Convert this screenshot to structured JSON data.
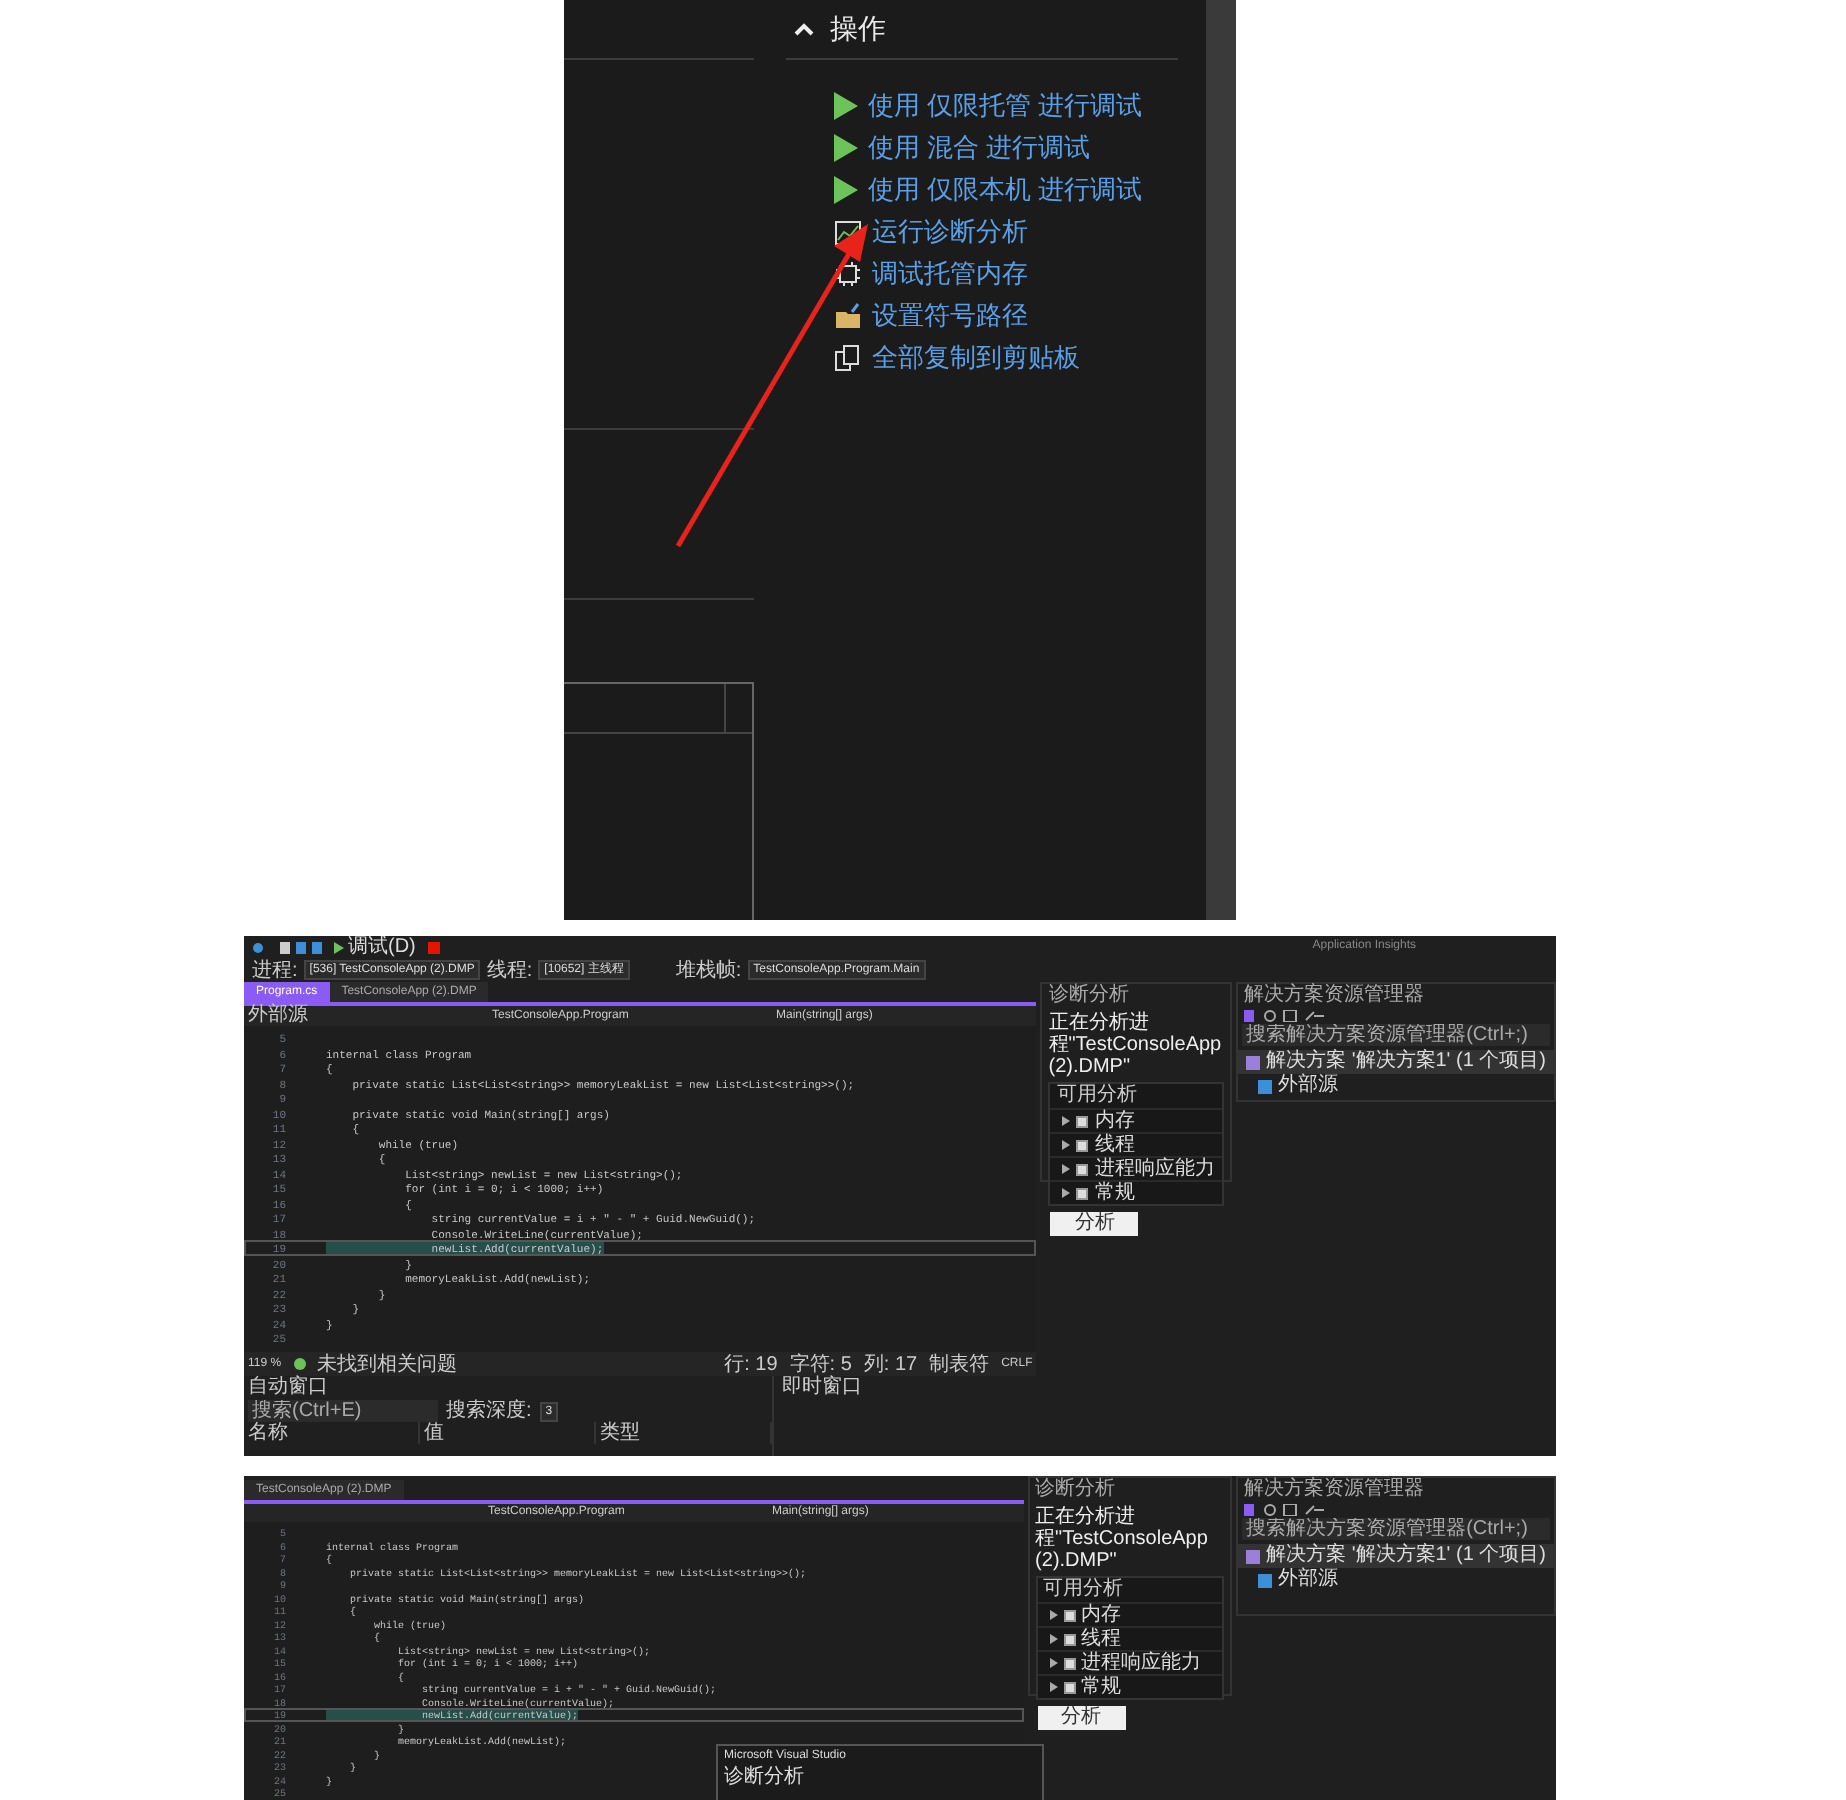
{
  "actions_panel": {
    "heading": "操作",
    "expanded": true,
    "items": [
      {
        "kind": "play",
        "label": "使用 仅限托管 进行调试"
      },
      {
        "kind": "play",
        "label": "使用 混合 进行调试"
      },
      {
        "kind": "play",
        "label": "使用 仅限本机 进行调试"
      },
      {
        "kind": "chart",
        "label": "运行诊断分析"
      },
      {
        "kind": "memory",
        "label": "调试托管内存"
      },
      {
        "kind": "folder",
        "label": "设置符号路径"
      },
      {
        "kind": "copy",
        "label": "全部复制到剪贴板"
      }
    ]
  },
  "debug_window": {
    "toolbar": {
      "debug_target": "调试(D)",
      "insights": "Application Insights",
      "process_label": "进程:",
      "process": "[536] TestConsoleApp (2).DMP",
      "thread_label": "线程:",
      "thread": "[10652] 主线程",
      "frame_label": "堆栈帧:",
      "frame": "TestConsoleApp.Program.Main"
    },
    "tabs": [
      {
        "label": "Program.cs",
        "selected": true
      },
      {
        "label": "TestConsoleApp (2).DMP",
        "selected": false
      }
    ],
    "nav": [
      "外部源",
      "TestConsoleApp.Program",
      "Main(string[] args)"
    ],
    "code": [
      {
        "no": "5"
      },
      {
        "no": "6",
        "text": "internal class Program"
      },
      {
        "no": "7",
        "text": "{"
      },
      {
        "no": "8",
        "text": "    private static List<List<string>> memoryLeakList = new List<List<string>>();"
      },
      {
        "no": "9"
      },
      {
        "no": "10",
        "text": "    private static void Main(string[] args)"
      },
      {
        "no": "11",
        "text": "    {"
      },
      {
        "no": "12",
        "text": "        while (true)"
      },
      {
        "no": "13",
        "text": "        {"
      },
      {
        "no": "14",
        "text": "            List<string> newList = new List<string>();"
      },
      {
        "no": "15",
        "text": "            for (int i = 0; i < 1000; i++)"
      },
      {
        "no": "16",
        "text": "            {"
      },
      {
        "no": "17",
        "text": "                string currentValue = i + \" - \" + Guid.NewGuid();"
      },
      {
        "no": "18",
        "text": "                Console.WriteLine(currentValue);"
      },
      {
        "no": "19",
        "text": "                newList.Add(currentValue);",
        "current": true
      },
      {
        "no": "20",
        "text": "            }"
      },
      {
        "no": "21",
        "text": "            memoryLeakList.Add(newList);"
      },
      {
        "no": "22",
        "text": "        }"
      },
      {
        "no": "23",
        "text": "    }"
      },
      {
        "no": "24",
        "text": "}"
      },
      {
        "no": "25"
      }
    ],
    "status": {
      "zoom": "119 %",
      "issues": "未找到相关问题",
      "line": "行: 19",
      "char": "字符: 5",
      "col": "列: 17",
      "tabs": "制表符",
      "eol": "CRLF"
    },
    "autos": {
      "title": "自动窗口",
      "search": {
        "placeholder": "搜索(Ctrl+E)"
      },
      "depth_label": "搜索深度:",
      "depth": "3",
      "columns": [
        "名称",
        "值",
        "类型"
      ]
    },
    "immediate": {
      "title": "即时窗口"
    },
    "diagnostics": {
      "title": "诊断分析",
      "heading": "正在分析进程\"TestConsoleApp (2).DMP\"",
      "group": "可用分析",
      "analyses": [
        {
          "label": "内存",
          "checked": true
        },
        {
          "label": "线程",
          "checked": true
        },
        {
          "label": "进程响应能力",
          "checked": true
        },
        {
          "label": "常规",
          "checked": true
        }
      ],
      "button": "分析"
    },
    "solution": {
      "title": "解决方案资源管理器",
      "search": {
        "placeholder": "搜索解决方案资源管理器(Ctrl+;)"
      },
      "root": "解决方案 '解决方案1' (1 个项目)",
      "child": "外部源"
    }
  },
  "second_window": {
    "tabs": [
      {
        "label": "TestConsoleApp (2).DMP",
        "selected": false
      }
    ],
    "nav": [
      "TestConsoleApp.Program",
      "Main(string[] args)"
    ],
    "code": [
      {
        "no": "5"
      },
      {
        "no": "6",
        "text": "internal class Program"
      },
      {
        "no": "7",
        "text": "{"
      },
      {
        "no": "8",
        "text": "    private static List<List<string>> memoryLeakList = new List<List<string>>();"
      },
      {
        "no": "9"
      },
      {
        "no": "10",
        "text": "    private static void Main(string[] args)"
      },
      {
        "no": "11",
        "text": "    {"
      },
      {
        "no": "12",
        "text": "        while (true)"
      },
      {
        "no": "13",
        "text": "        {"
      },
      {
        "no": "14",
        "text": "            List<string> newList = new List<string>();"
      },
      {
        "no": "15",
        "text": "            for (int i = 0; i < 1000; i++)"
      },
      {
        "no": "16",
        "text": "            {"
      },
      {
        "no": "17",
        "text": "                string currentValue = i + \" - \" + Guid.NewGuid();"
      },
      {
        "no": "18",
        "text": "                Console.WriteLine(currentValue);"
      },
      {
        "no": "19",
        "text": "                newList.Add(currentValue);",
        "current": true
      },
      {
        "no": "20",
        "text": "            }"
      },
      {
        "no": "21",
        "text": "            memoryLeakList.Add(newList);"
      },
      {
        "no": "22",
        "text": "        }"
      },
      {
        "no": "23",
        "text": "    }"
      },
      {
        "no": "24",
        "text": "}"
      },
      {
        "no": "25"
      }
    ],
    "dialog": {
      "title": "Microsoft Visual Studio",
      "line": "诊断分析"
    },
    "diagnostics": {
      "title": "诊断分析",
      "heading": "正在分析进程\"TestConsoleApp (2).DMP\"",
      "group": "可用分析",
      "analyses": [
        {
          "label": "内存",
          "checked": true
        },
        {
          "label": "线程",
          "checked": true
        },
        {
          "label": "进程响应能力",
          "checked": true
        },
        {
          "label": "常规",
          "checked": true
        }
      ],
      "button": "分析"
    },
    "solution": {
      "title": "解决方案资源管理器",
      "search": {
        "placeholder": "搜索解决方案资源管理器(Ctrl+;)"
      },
      "root": "解决方案 '解决方案1' (1 个项目)",
      "child": "外部源"
    }
  }
}
